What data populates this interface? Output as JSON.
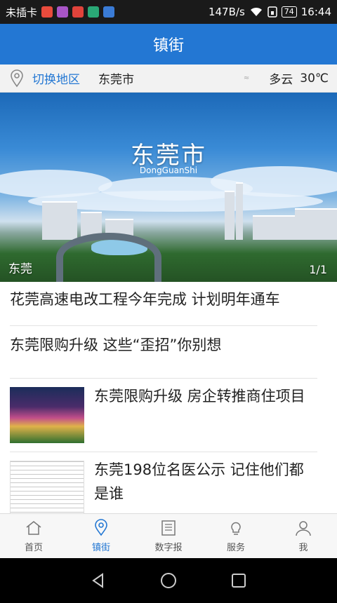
{
  "status_bar": {
    "carrier": "未插卡",
    "speed": "147B/s",
    "battery": "74",
    "time": "16:44"
  },
  "header": {
    "title": "镇街"
  },
  "location": {
    "switch_label": "切换地区",
    "city": "东莞市",
    "weather": "多云",
    "temperature": "30℃"
  },
  "banner": {
    "title": "东莞市",
    "subtitle": "DongGuanShi",
    "caption": "东莞",
    "pager": "1/1"
  },
  "news": [
    {
      "title": "花莞高速电改工程今年完成 计划明年通车"
    },
    {
      "title": "东莞限购升级 这些“歪招”你别想"
    },
    {
      "title": "东莞限购升级 房企转推商住项目"
    },
    {
      "title": "东莞198位名医公示 记住他们都是谁"
    }
  ],
  "tabs": [
    {
      "label": "首页",
      "icon": "home-icon"
    },
    {
      "label": "镇街",
      "icon": "location-pin-icon"
    },
    {
      "label": "数字报",
      "icon": "newspaper-icon"
    },
    {
      "label": "服务",
      "icon": "lightbulb-icon"
    },
    {
      "label": "我",
      "icon": "user-icon"
    }
  ],
  "colors": {
    "accent": "#2377d3"
  }
}
